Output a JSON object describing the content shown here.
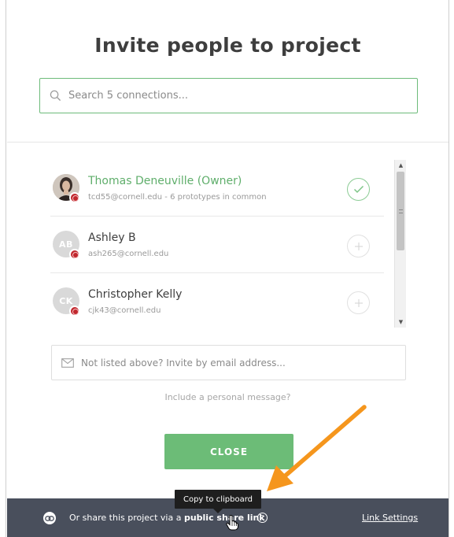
{
  "dialog": {
    "title": "Invite people to project",
    "search_placeholder": "Search 5 connections..."
  },
  "connections": [
    {
      "name": "Thomas Deneuville (Owner)",
      "sub": "tcd55@cornell.edu - 6 prototypes in common",
      "initials": "",
      "is_owner": true,
      "added": true
    },
    {
      "name": "Ashley B",
      "sub": "ash265@cornell.edu",
      "initials": "AB",
      "is_owner": false,
      "added": false
    },
    {
      "name": "Christopher Kelly",
      "sub": "cjk43@cornell.edu",
      "initials": "CK",
      "is_owner": false,
      "added": false
    }
  ],
  "invite": {
    "placeholder": "Not listed above? Invite by email address...",
    "personal_message": "Include a personal message?"
  },
  "close_label": "CLOSE",
  "tooltip": "Copy to clipboard",
  "footer": {
    "text_prefix": "Or share this project via a ",
    "text_link": "public share link",
    "link_settings": "Link Settings"
  },
  "colors": {
    "accent_green": "#6cbc77",
    "footer_bg": "#494f5c",
    "annotation_arrow": "#f5961d",
    "university_badge": "#c1272d"
  },
  "icons": {
    "search": "search-icon",
    "envelope": "envelope-icon",
    "check": "check-icon",
    "plus": "plus-icon",
    "link": "link-icon",
    "help": "help-icon",
    "cursor": "hand-cursor-icon"
  }
}
